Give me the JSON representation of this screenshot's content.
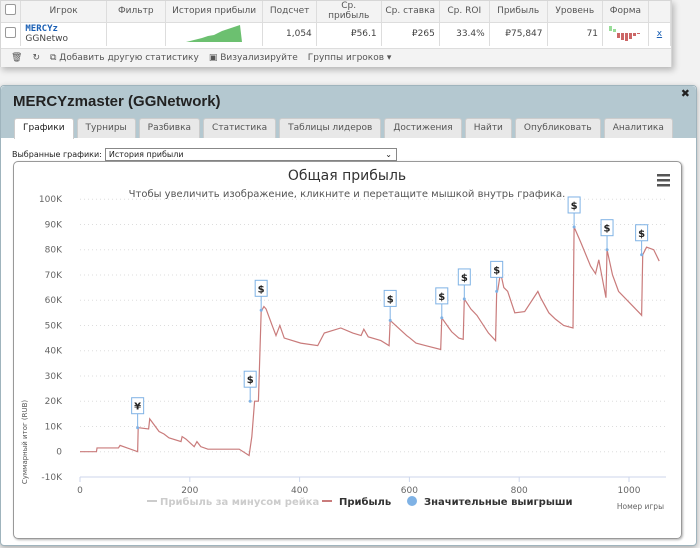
{
  "table": {
    "headers": [
      "Игрок",
      "Фильтр",
      "История прибыли",
      "Подсчет",
      "Ср. прибыль",
      "Ср. ставка",
      "Ср. ROI",
      "Прибыль",
      "Уровень",
      "Форма"
    ],
    "row": {
      "player": "MERCYz",
      "network": "GGNetwo",
      "count": "1,054",
      "avg_profit": "₽56.1",
      "avg_stake": "₽265",
      "avg_roi": "33.4%",
      "profit": "₽75,847",
      "level": "71",
      "remove": "x"
    },
    "footer": {
      "add_stat": "Добавить другую статистику",
      "visualize": "Визуализируйте",
      "groups": "Группы игроков ▾"
    }
  },
  "dialog": {
    "title": "MERCYzmaster (GGNetwork)",
    "close": "✖",
    "tabs": [
      "Графики",
      "Турниры",
      "Разбивка",
      "Статистика",
      "Таблицы лидеров",
      "Достижения",
      "Найти",
      "Опубликовать",
      "Аналитика"
    ],
    "active_tab": "Графики",
    "select_label": "Выбранные графики:",
    "select_value": "История прибыли"
  },
  "chart_data": {
    "type": "line",
    "title": "Общая прибыль",
    "subtitle": "Чтобы увеличить изображение, кликните и перетащите мышкой внутрь графика.",
    "xlabel": "Номер игры",
    "ylabel": "Суммарный итог (RUB)",
    "xlim": [
      0,
      1060
    ],
    "ylim": [
      -10000,
      100000
    ],
    "xticks": [
      "0",
      "200",
      "400",
      "600",
      "800",
      "1000"
    ],
    "yticks": [
      "-10K",
      "0",
      "10K",
      "20K",
      "30K",
      "40K",
      "50K",
      "60K",
      "70K",
      "80K",
      "90K",
      "100K"
    ],
    "grid": "horizontal dotted",
    "legend_placement": "bottom",
    "colors": {
      "profit": "#c97b7b",
      "rake": "#cccccc",
      "wins": "#7fb2e5"
    },
    "series": [
      {
        "name": "Прибыль за минусом рейка",
        "hidden": true,
        "values": []
      },
      {
        "name": "Прибыль",
        "x": [
          0,
          30,
          31,
          70,
          73,
          105,
          106,
          125,
          127,
          144,
          153,
          162,
          184,
          186,
          193,
          208,
          213,
          220,
          233,
          290,
          308,
          313,
          318,
          325,
          330,
          335,
          339,
          350,
          357,
          364,
          372,
          402,
          433,
          445,
          475,
          497,
          512,
          517,
          525,
          548,
          563,
          565,
          595,
          601,
          612,
          630,
          657,
          659,
          672,
          677,
          690,
          698,
          700,
          712,
          723,
          744,
          757,
          759,
          761,
          766,
          772,
          779,
          792,
          810,
          834,
          839,
          854,
          866,
          881,
          898,
          900,
          912,
          930,
          939,
          945,
          958,
          960,
          970,
          981,
          1021,
          1023,
          1025,
          1032,
          1045,
          1055
        ],
        "y": [
          0,
          0,
          1500,
          1500,
          2500,
          0,
          9500,
          9000,
          13000,
          8000,
          7000,
          5500,
          4000,
          6000,
          5000,
          2000,
          4000,
          2000,
          1000,
          1000,
          -1500,
          6000,
          20000,
          20000,
          55500,
          57500,
          56500,
          50000,
          46000,
          50000,
          45000,
          43000,
          42000,
          47000,
          49000,
          47000,
          46000,
          48500,
          45500,
          44000,
          42000,
          52000,
          46000,
          45000,
          43000,
          42000,
          40500,
          53000,
          49000,
          47500,
          45000,
          44500,
          60500,
          56500,
          54000,
          47000,
          44000,
          63500,
          64000,
          71000,
          65000,
          63500,
          55000,
          55500,
          63500,
          61000,
          55000,
          52500,
          50000,
          49000,
          89000,
          83000,
          73500,
          70500,
          76000,
          61000,
          80000,
          70000,
          63500,
          54500,
          54000,
          78000,
          81000,
          80000,
          75500
        ]
      },
      {
        "name": "Значительные выигрыши",
        "points": [
          {
            "x": 105,
            "y": 9500,
            "symbol": "¥"
          },
          {
            "x": 310,
            "y": 20000,
            "symbol": "$"
          },
          {
            "x": 330,
            "y": 56000,
            "symbol": "$"
          },
          {
            "x": 565,
            "y": 52000,
            "symbol": "$"
          },
          {
            "x": 659,
            "y": 53000,
            "symbol": "$"
          },
          {
            "x": 700,
            "y": 60500,
            "symbol": "$"
          },
          {
            "x": 759,
            "y": 63500,
            "symbol": "$"
          },
          {
            "x": 900,
            "y": 89000,
            "symbol": "$"
          },
          {
            "x": 960,
            "y": 80000,
            "symbol": "$"
          },
          {
            "x": 1023,
            "y": 78000,
            "symbol": "$"
          }
        ]
      }
    ]
  }
}
